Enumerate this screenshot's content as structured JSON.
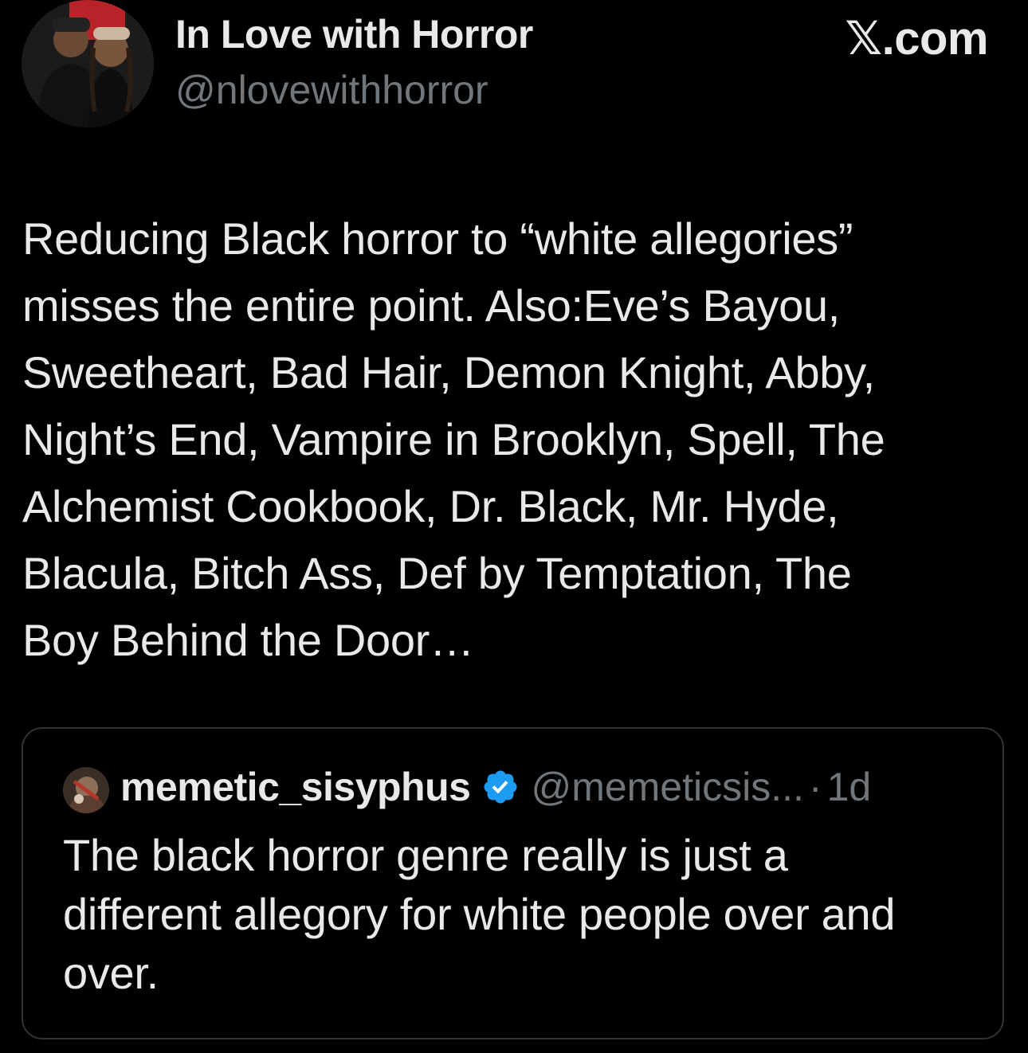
{
  "author": {
    "name": "In Love with Horror",
    "handle": "@nlovewithhorror",
    "avatar_icon": "profile-photo-icon"
  },
  "site": {
    "logo": "𝕏.com"
  },
  "tweet": {
    "lines": [
      "Reducing Black horror to “white allegories”",
      "misses the entire point. Also:Eve’s Bayou,",
      "Sweetheart, Bad Hair, Demon Knight, Abby,",
      "Night’s End, Vampire in Brooklyn, Spell, The",
      "Alchemist Cookbook, Dr. Black, Mr. Hyde,",
      "Blacula, Bitch Ass, Def by Temptation, The",
      "Boy Behind the Door…"
    ]
  },
  "quote": {
    "name": "memetic_sisyphus",
    "verified_icon": "verified-badge-icon",
    "verified_color": "#1d9bf0",
    "handle": "@memeticsis...",
    "separator": "·",
    "time": "1d",
    "lines": [
      "The black horror genre really is just a",
      "different allegory for white people over and",
      "over."
    ]
  },
  "colors": {
    "background": "#000000",
    "text_primary": "#e7e9ea",
    "text_secondary": "#71767b",
    "border": "#2f3336"
  }
}
